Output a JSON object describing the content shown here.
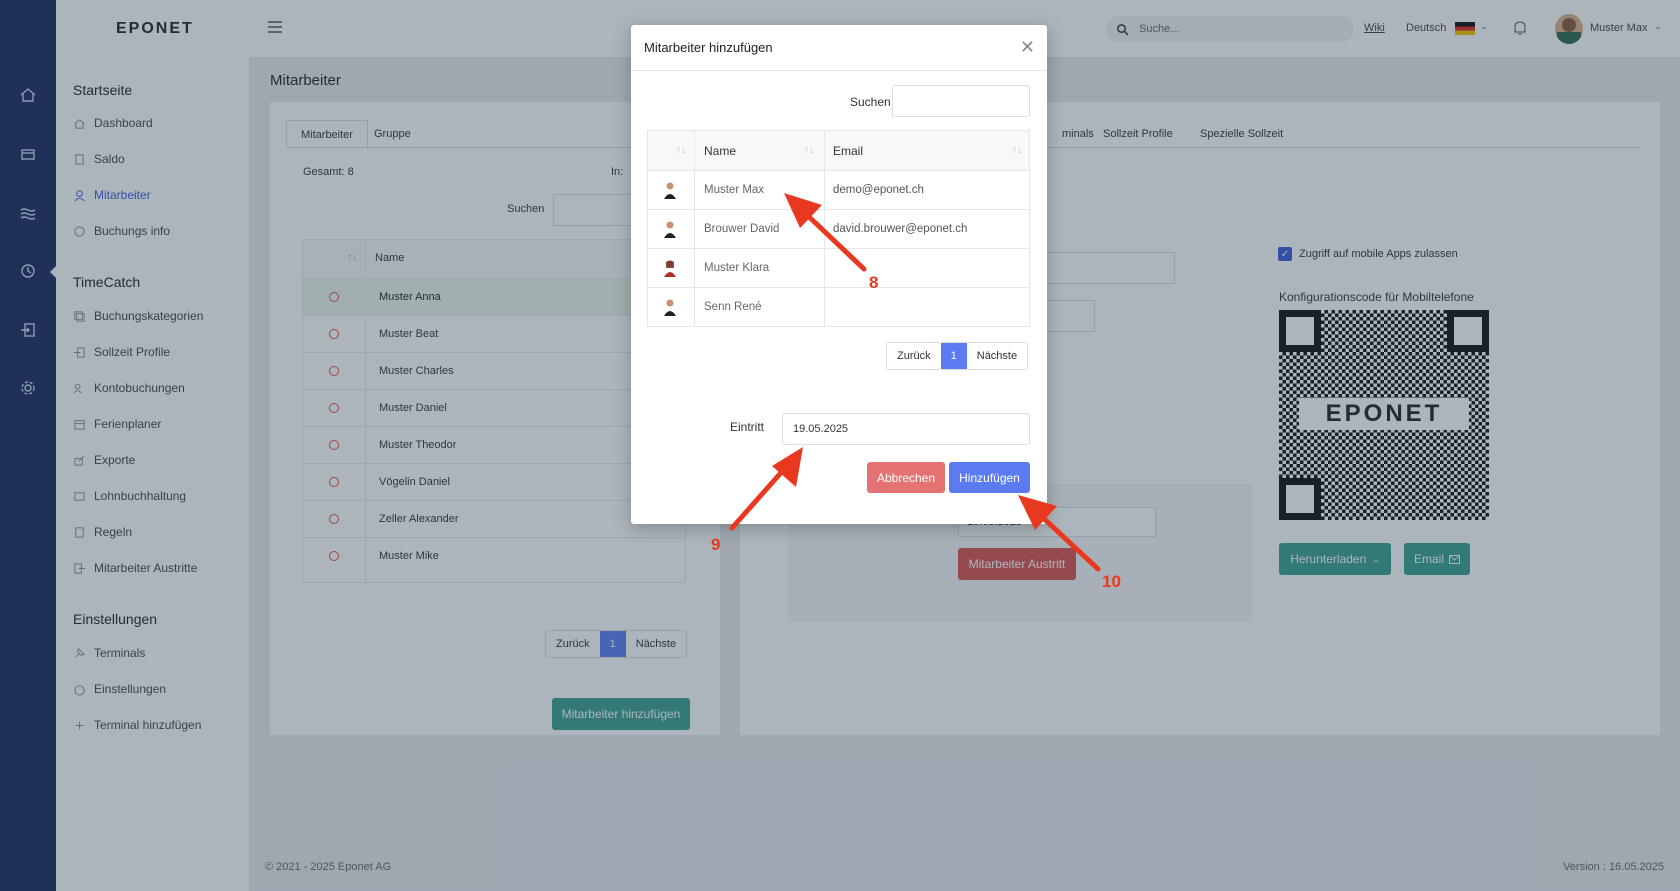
{
  "app": {
    "logo": "EPONET"
  },
  "topbar": {
    "search_placeholder": "Suche...",
    "wiki": "Wiki",
    "language": "Deutsch",
    "user_name": "Muster Max"
  },
  "sidebar": {
    "section1": "Startseite",
    "items1": [
      "Dashboard",
      "Saldo",
      "Mitarbeiter",
      "Buchungs info"
    ],
    "section2": "TimeCatch",
    "items2": [
      "Buchungskategorien",
      "Sollzeit Profile",
      "Kontobuchungen",
      "Ferienplaner",
      "Exporte",
      "Lohnbuchhaltung",
      "Regeln",
      "Mitarbeiter Austritte"
    ],
    "section3": "Einstellungen",
    "items3": [
      "Terminals",
      "Einstellungen",
      "Terminal hinzufügen"
    ]
  },
  "main": {
    "title": "Mitarbeiter",
    "tabs": [
      "Mitarbeiter",
      "Gruppe"
    ],
    "gesamt": "Gesamt:  8",
    "in_label": "In:",
    "search_label": "Suchen",
    "col_name": "Name",
    "employees": [
      "Muster Anna",
      "Muster Beat",
      "Muster Charles",
      "Muster Daniel",
      "Muster Theodor",
      "Vögelin Daniel",
      "Zeller Alexander",
      "Muster Mike"
    ],
    "pager": {
      "prev": "Zurück",
      "page": "1",
      "next": "Nächste"
    },
    "add_button": "Mitarbeiter hinzufügen",
    "right_tabs": [
      "minals",
      "Sollzeit Profile",
      "Spezielle Sollzeit"
    ],
    "mobile_checkbox": "Zugriff auf mobile Apps zulassen",
    "config_title": "Konfigurationscode für Mobiltelefone",
    "qr_label": "EPONET",
    "download_button": "Herunterladen",
    "email_button": "Email",
    "exit_button": "Mitarbeiter Austritt",
    "exit_date": "19.05.2025"
  },
  "footer": {
    "copyright": "© 2021 - 2025 Eponet AG",
    "version": "Version :  16.05.2025"
  },
  "modal": {
    "title": "Mitarbeiter hinzufügen",
    "search_label": "Suchen",
    "col_name": "Name",
    "col_email": "Email",
    "rows": [
      {
        "name": "Muster Max",
        "email": "demo@eponet.ch",
        "avatar": "male"
      },
      {
        "name": "Brouwer David",
        "email": "david.brouwer@eponet.ch",
        "avatar": "male"
      },
      {
        "name": "Muster Klara",
        "email": "",
        "avatar": "female"
      },
      {
        "name": "Senn René",
        "email": "",
        "avatar": "male"
      }
    ],
    "pager": {
      "prev": "Zurück",
      "page": "1",
      "next": "Nächste"
    },
    "eintritt_label": "Eintritt",
    "eintritt_value": "19.05.2025",
    "cancel_button": "Abbrechen",
    "add_button": "Hinzufügen"
  },
  "annotations": [
    "8",
    "9",
    "10"
  ],
  "colors": {
    "rail": "#1a2b5e",
    "primary": "#5b7bf0",
    "danger": "#e57373",
    "teal": "#3aa08f",
    "arrow": "#e8381f"
  }
}
